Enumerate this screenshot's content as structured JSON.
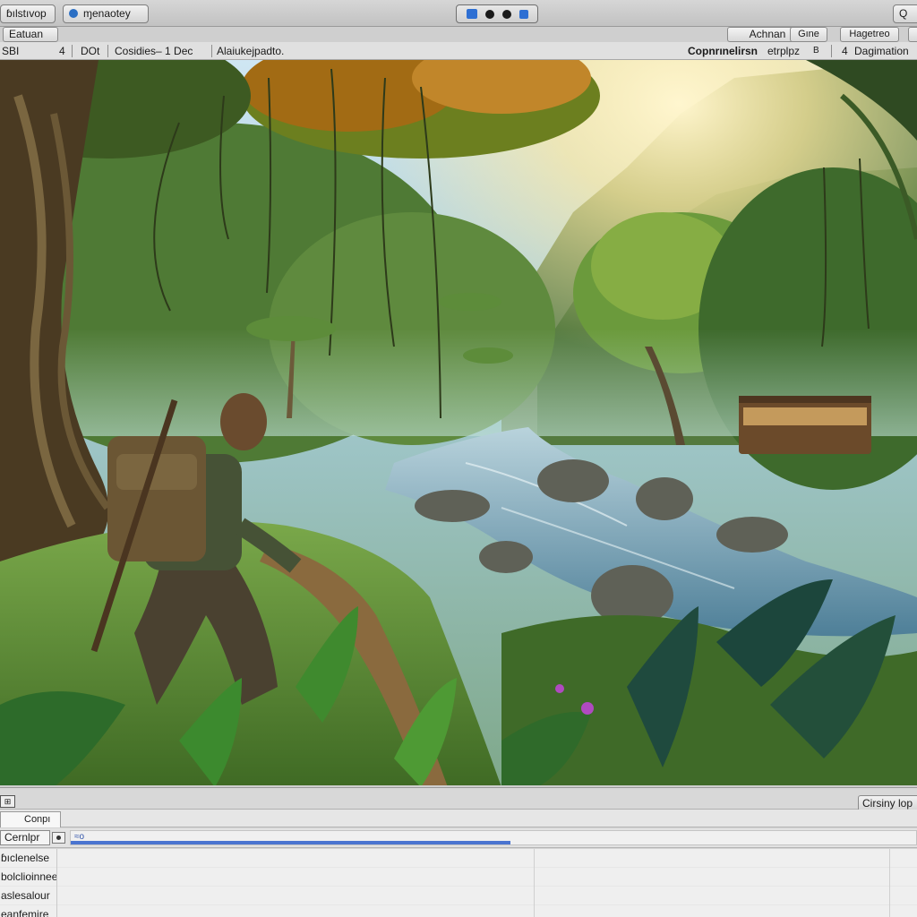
{
  "toolbar": {
    "dropdown_label": "ɓılstıvop",
    "layer_label": "ɱenaotey",
    "right_label": "Q"
  },
  "toolbar2": {
    "edit_label": "Eatuan",
    "action_label": "Achnan",
    "grid_label": "Gıne",
    "layout_label": "Hagetreo",
    "right_label": ""
  },
  "tabs": {
    "left_a": "SBI",
    "left_num": "4",
    "dot_label": "DOt",
    "crumb": "Cosidies–  1  Dec",
    "path": "Alaiukejpadto.",
    "right_label": "Copnrınelirsn",
    "right_sub": "etrplpz",
    "right_badge": "B",
    "layout_num": "4",
    "layout_label": "Dagimation"
  },
  "colors": {
    "accent": "#2e6fd3",
    "progress": "#4a74d0",
    "panel_bg": "#d4d4d4"
  },
  "bottom": {
    "mini_icon": "⊞",
    "right_btn": "Cirsiny lop",
    "tab_label": "Conpı",
    "console_label": "Cernlpr",
    "progress_text": "≈o",
    "progress_value": 0.52,
    "items": [
      "ɓıclenelse",
      "bolclioinnee",
      "aslesalour",
      "eanfemire"
    ]
  }
}
